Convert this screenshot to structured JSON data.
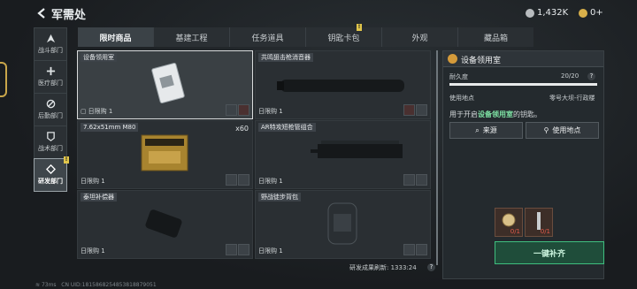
{
  "header": {
    "title": "军需处",
    "currency_1": "1,432K",
    "currency_2": "0+"
  },
  "nav": [
    {
      "label": "战斗部门",
      "icon": "combat-icon",
      "active": false
    },
    {
      "label": "医疗部门",
      "icon": "medical-icon",
      "active": false
    },
    {
      "label": "后勤部门",
      "icon": "logistics-icon",
      "active": false
    },
    {
      "label": "战术部门",
      "icon": "tactical-icon",
      "active": false
    },
    {
      "label": "研发部门",
      "icon": "research-icon",
      "active": true,
      "badge": "!"
    }
  ],
  "tabs": [
    {
      "label": "限时商品",
      "active": true
    },
    {
      "label": "基建工程"
    },
    {
      "label": "任务道具"
    },
    {
      "label": "钥匙卡包",
      "badge": "!"
    },
    {
      "label": "外观"
    },
    {
      "label": "藏品箱"
    }
  ],
  "items": [
    {
      "name": "设备领用室",
      "limit": "日限购 1",
      "selected": true,
      "qty": ""
    },
    {
      "name": "共鸣狙击枪消音器",
      "limit": "日限购 1",
      "qty": ""
    },
    {
      "name": "7.62x51mm M80",
      "limit": "日限购 1",
      "qty": "x60"
    },
    {
      "name": "AR特攻短枪管组合",
      "limit": "日限购 1",
      "qty": ""
    },
    {
      "name": "泰坦补偿器",
      "limit": "日限购 1",
      "qty": ""
    },
    {
      "name": "野战徒步背包",
      "limit": "日限购 1",
      "qty": ""
    }
  ],
  "refresh": {
    "label": "研发成果刷新: 1333:24"
  },
  "detail": {
    "title": "设备领用室",
    "durability_label": "耐久度",
    "durability_value": "20/20",
    "durability_fraction": 1.0,
    "location_label": "使用地点",
    "location_value": "零号大坝-行政楼",
    "desc_prefix": "用于开启",
    "desc_highlight": "设备领用室",
    "desc_suffix": "的钥匙。",
    "source_button": "来源",
    "use_location_button": "使用地点",
    "cost_slots": [
      {
        "count": "0/1"
      },
      {
        "count": "0/1"
      }
    ],
    "fill_button": "一键补齐"
  },
  "status": {
    "ping": "73ms",
    "uid": "CN UID:1815868254853818879051"
  },
  "colors": {
    "accent_green": "#3fbf7f",
    "highlight_green": "#7fe3a5",
    "badge_yellow": "#e0c54a"
  }
}
